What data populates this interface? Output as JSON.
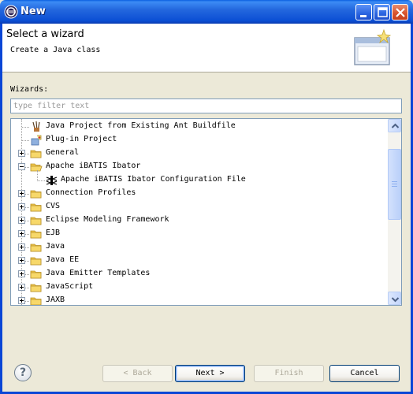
{
  "window": {
    "title": "New"
  },
  "banner": {
    "title": "Select a wizard",
    "description": "Create a Java class"
  },
  "wizards": {
    "label": "Wizards:",
    "filter_placeholder": "type filter text",
    "items": [
      {
        "label": "Java Project from Existing Ant Buildfile",
        "icon": "ant-icon",
        "expander": "none"
      },
      {
        "label": "Plug-in Project",
        "icon": "plugin-project-icon",
        "expander": "none"
      },
      {
        "label": "General",
        "icon": "folder-icon",
        "expander": "plus"
      },
      {
        "label": "Apache iBATIS Ibator",
        "icon": "folder-open-icon",
        "expander": "minus"
      },
      {
        "label": "Apache iBATIS Ibator Configuration File",
        "icon": "ibator-file-icon",
        "expander": "none"
      },
      {
        "label": "Connection Profiles",
        "icon": "folder-icon",
        "expander": "plus"
      },
      {
        "label": "CVS",
        "icon": "folder-icon",
        "expander": "plus"
      },
      {
        "label": "Eclipse Modeling Framework",
        "icon": "folder-icon",
        "expander": "plus"
      },
      {
        "label": "EJB",
        "icon": "folder-icon",
        "expander": "plus"
      },
      {
        "label": "Java",
        "icon": "folder-icon",
        "expander": "plus"
      },
      {
        "label": "Java EE",
        "icon": "folder-icon",
        "expander": "plus"
      },
      {
        "label": "Java Emitter Templates",
        "icon": "folder-icon",
        "expander": "plus"
      },
      {
        "label": "JavaScript",
        "icon": "folder-icon",
        "expander": "plus"
      },
      {
        "label": "JAXB",
        "icon": "folder-icon",
        "expander": "plus"
      }
    ]
  },
  "buttons": {
    "help": "?",
    "back": "< Back",
    "next": "Next >",
    "finish": "Finish",
    "cancel": "Cancel"
  }
}
